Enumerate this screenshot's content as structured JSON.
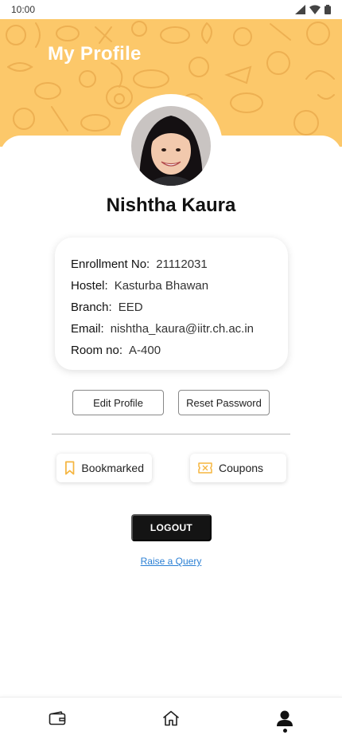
{
  "status_bar": {
    "time": "10:00"
  },
  "header": {
    "title": "My Profile"
  },
  "profile": {
    "name": "Nishtha Kaura",
    "details": [
      {
        "label": "Enrollment No:",
        "value": "21112031"
      },
      {
        "label": "Hostel:",
        "value": "Kasturba Bhawan"
      },
      {
        "label": "Branch:",
        "value": "EED"
      },
      {
        "label": "Email:",
        "value": "nishtha_kaura@iitr.ch.ac.in"
      },
      {
        "label": "Room no:",
        "value": "A-400"
      }
    ]
  },
  "actions": {
    "edit_profile": "Edit Profile",
    "reset_password": "Reset Password",
    "bookmarked": "Bookmarked",
    "coupons": "Coupons",
    "logout": "LOGOUT",
    "raise_query": "Raise a Query"
  },
  "colors": {
    "header_bg": "#fcc86a",
    "accent_icon": "#f5b53f",
    "link": "#2a7fd4",
    "logout_bg": "#141414"
  },
  "bottom_nav": {
    "items": [
      {
        "icon": "wallet-icon"
      },
      {
        "icon": "home-icon"
      },
      {
        "icon": "profile-icon",
        "active": true
      }
    ]
  }
}
